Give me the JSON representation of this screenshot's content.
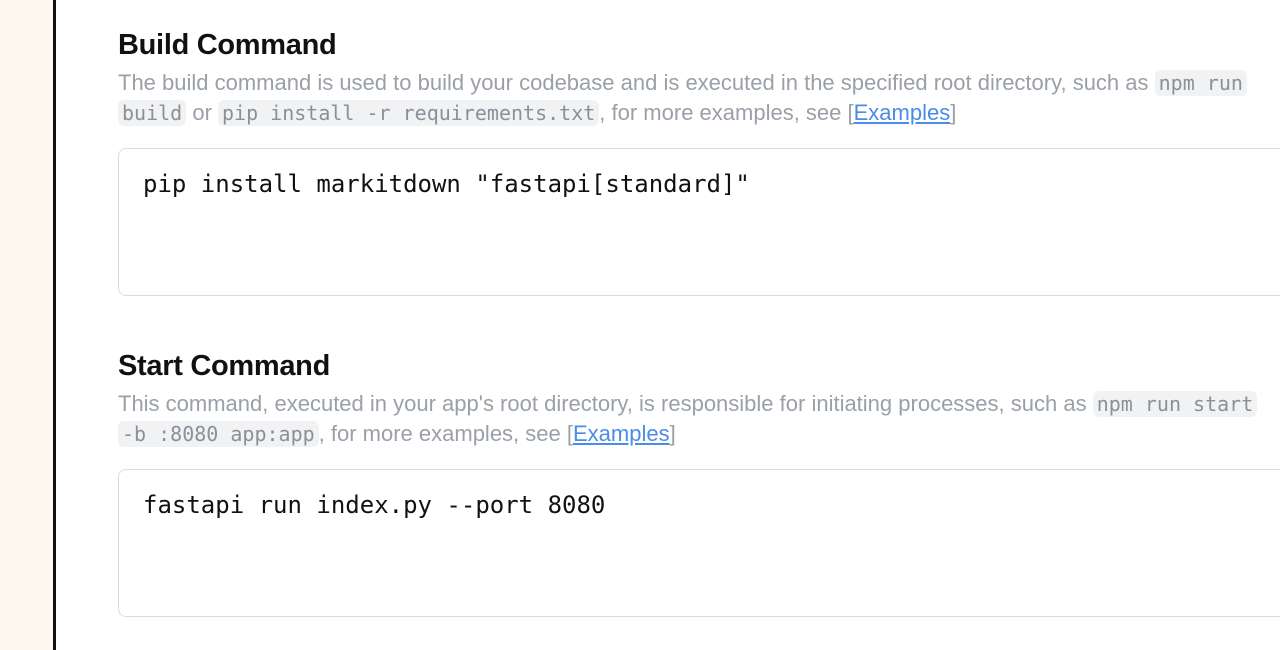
{
  "build": {
    "title": "Build Command",
    "desc_line1": "The build command is used to build your codebase and is executed in the specified root directory, such as ",
    "desc_code_a_line1": "npm run",
    "desc_code_a_line2": "build",
    "desc_or": " or ",
    "desc_code_b": "pip install -r requirements.txt",
    "desc_more": ", for more examples, see [",
    "desc_link": "Examples",
    "desc_close": "]",
    "value": "pip install markitdown \"fastapi[standard]\""
  },
  "start": {
    "title": "Start Command",
    "desc_line1": "This command, executed in your app's root directory, is responsible for initiating processes, such as ",
    "desc_code_a_line1": "npm run start",
    "desc_code_a_line2": "-b :8080 app:app",
    "desc_more": ", for more examples, see [",
    "desc_link": "Examples",
    "desc_close": "]",
    "value": "fastapi run index.py --port 8080"
  }
}
